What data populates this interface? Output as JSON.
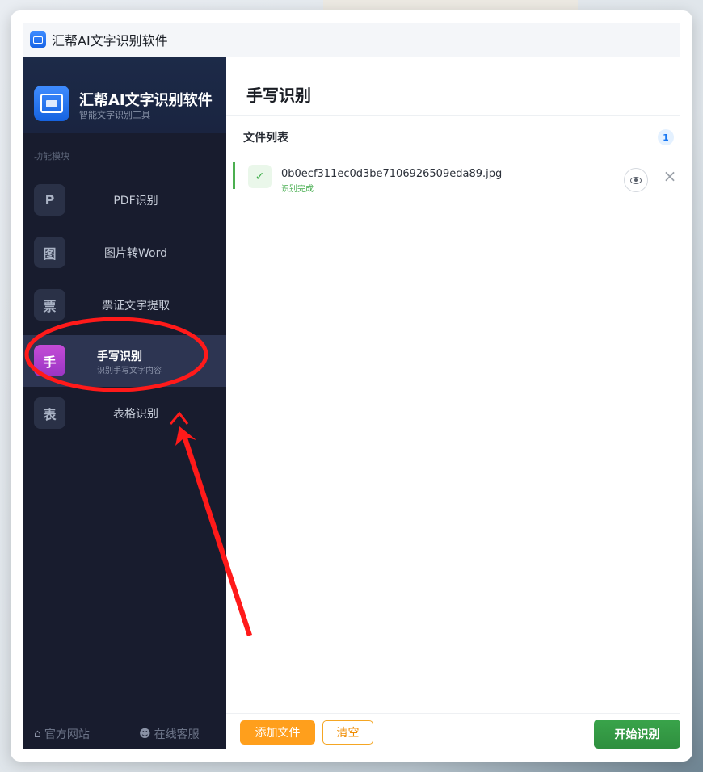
{
  "window": {
    "title": "汇帮AI文字识别软件"
  },
  "sidebar": {
    "brand_name": "汇帮AI文字识别软件",
    "brand_subtitle": "智能文字识别工具",
    "section_label": "功能模块",
    "items": [
      {
        "badge": "P",
        "label": "PDF识别"
      },
      {
        "badge": "图",
        "label": "图片转Word"
      },
      {
        "badge": "票",
        "label": "票证文字提取"
      },
      {
        "badge": "手",
        "label": "手写识别",
        "sublabel": "识别手写文字内容",
        "active": true
      },
      {
        "badge": "表",
        "label": "表格识别"
      }
    ],
    "footer": {
      "website_label": "官方网站",
      "support_label": "在线客服"
    }
  },
  "main": {
    "page_title": "手写识别",
    "list_header": "文件列表",
    "file_count": "1",
    "files": [
      {
        "name": "0b0ecf311ec0d3be7106926509eda89.jpg",
        "status": "识别完成",
        "status_icon": "check-icon"
      }
    ],
    "buttons": {
      "add_files": "添加文件",
      "clear": "清空",
      "start": "开始识别"
    }
  },
  "annotation": {
    "color": "#ff1a1a"
  },
  "colors": {
    "sidebar_bg": "#181c2e",
    "active_badge": "#b040cc",
    "success": "#4caf50",
    "add_button": "#ff9f1c",
    "start_button": "#39a44a"
  }
}
